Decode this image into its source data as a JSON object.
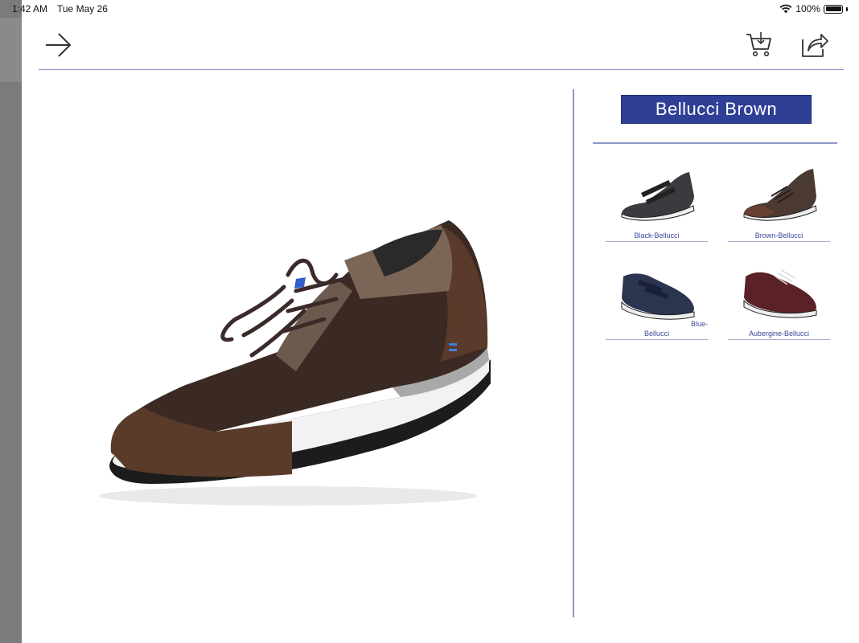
{
  "status_bar": {
    "time": "1:42 AM",
    "date": "Tue May 26",
    "battery_text": "100%",
    "battery_level": 1.0
  },
  "toolbar": {
    "back_icon": "arrow-right-icon",
    "cart_icon": "cart-download-icon",
    "share_icon": "share-icon"
  },
  "product": {
    "title": "Bellucci  Brown",
    "main_image": "brown-lace-up-shoe",
    "title_color": "#2f3f96"
  },
  "variants": [
    {
      "label": "Black-Bellucci",
      "color": "#3a3b3e",
      "style": "velcro"
    },
    {
      "label": "Brown-Bellucci",
      "color": "#4a3a32",
      "style": "lace"
    },
    {
      "label_part1": "Blue-",
      "label_part2": "Bellucci",
      "color": "#2c3550",
      "style": "velcro"
    },
    {
      "label": "Aubergine-Bellucci",
      "color": "#5a2226",
      "style": "lace"
    }
  ]
}
